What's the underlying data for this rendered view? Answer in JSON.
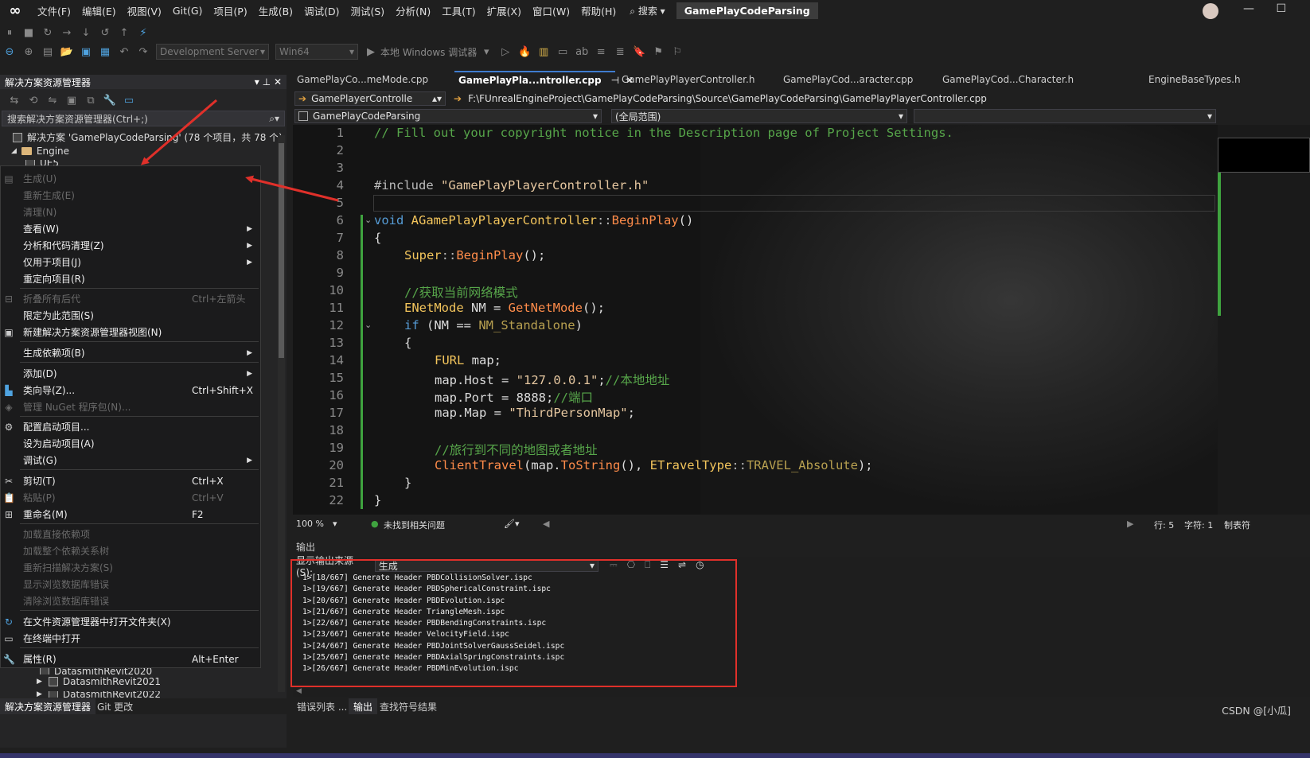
{
  "menubar": {
    "items": [
      "文件(F)",
      "编辑(E)",
      "视图(V)",
      "Git(G)",
      "项目(P)",
      "生成(B)",
      "调试(D)",
      "测试(S)",
      "分析(N)",
      "工具(T)",
      "扩展(X)",
      "窗口(W)",
      "帮助(H)"
    ],
    "search_label": "搜索",
    "solution_name": "GamePlayCodeParsing"
  },
  "toolbar": {
    "config_combo": "Development Server",
    "platform_combo": "Win64",
    "debugger_label": "本地 Windows 调试器"
  },
  "solution_explorer": {
    "title": "解决方案资源管理器",
    "search_placeholder": "搜索解决方案资源管理器(Ctrl+;)",
    "solution_node": "解决方案 'GamePlayCodeParsing' (78 个项目，共 78 个)",
    "engine_folder": "Engine",
    "ue5_node": "UE5",
    "node_datasmith2020": "DatasmithRevit2020",
    "node_datasmith2021": "DatasmithRevit2021",
    "node_datasmith2022": "DatasmithRevit2022",
    "tab_solution": "解决方案资源管理器",
    "tab_git": "Git 更改"
  },
  "context_menu": {
    "build": "生成(U)",
    "rebuild": "重新生成(E)",
    "clean": "清理(N)",
    "view": "查看(W)",
    "analyze": "分析和代码清理(Z)",
    "project_only": "仅用于项目(J)",
    "retarget": "重定向项目(R)",
    "collapse": "折叠所有后代",
    "collapse_sc": "Ctrl+左箭头",
    "scope": "限定为此范围(S)",
    "new_view": "新建解决方案资源管理器视图(N)",
    "build_deps": "生成依赖项(B)",
    "add": "添加(D)",
    "class_wizard": "类向导(Z)...",
    "class_wizard_sc": "Ctrl+Shift+X",
    "nuget": "管理 NuGet 程序包(N)...",
    "config_startup": "配置启动项目...",
    "set_startup": "设为启动项目(A)",
    "debug": "调试(G)",
    "cut": "剪切(T)",
    "cut_sc": "Ctrl+X",
    "paste": "粘贴(P)",
    "paste_sc": "Ctrl+V",
    "rename": "重命名(M)",
    "rename_sc": "F2",
    "load_direct": "加载直接依赖项",
    "load_tree": "加载整个依赖关系树",
    "rescan": "重新扫描解决方案(S)",
    "show_db_errors": "显示浏览数据库错误",
    "clear_db_errors": "清除浏览数据库错误",
    "open_folder": "在文件资源管理器中打开文件夹(X)",
    "open_terminal": "在终端中打开",
    "properties": "属性(R)",
    "properties_sc": "Alt+Enter"
  },
  "editor_tabs": [
    "GamePlayCo...meMode.cpp",
    "GamePlayPla...ntroller.cpp",
    "GamePlayPlayerController.h",
    "GamePlayCod...aracter.cpp",
    "GamePlayCod...Character.h",
    "EngineBaseTypes.h"
  ],
  "nav": {
    "class_combo": "GamePlayerControlle",
    "path": "F:\\FUnrealEngineProject\\GamePlayCodeParsing\\Source\\GamePlayCodeParsing\\GamePlayPlayerController.cpp",
    "project_combo": "GamePlayCodeParsing",
    "scope_combo": "(全局范围)"
  },
  "code": {
    "line_numbers": [
      "1",
      "2",
      "3",
      "4",
      "5",
      "6",
      "7",
      "8",
      "9",
      "10",
      "11",
      "12",
      "13",
      "14",
      "15",
      "16",
      "17",
      "18",
      "19",
      "20",
      "21",
      "22"
    ],
    "l1": "// Fill out your copyright notice in the Description page of Project Settings.",
    "l4_kw": "#include",
    "l4_str": "\"GamePlayPlayerController.h\"",
    "l6_kw": "void",
    "l6_type": "AGamePlayPlayerController",
    "l6_op": "::",
    "l6_fn": "BeginPlay",
    "l6_rest": "()",
    "l7": "{",
    "l8_type": "Super",
    "l8_op": "::",
    "l8_fn": "BeginPlay",
    "l8_rest": "();",
    "l10": "//获取当前网络模式",
    "l11_type": "ENetMode",
    "l11_mid": " NM = ",
    "l11_fn": "GetNetMode",
    "l11_rest": "();",
    "l12_kw": "if",
    "l12_mid": " (NM == ",
    "l12_enum": "NM_Standalone",
    "l12_rest": ")",
    "l13": "{",
    "l14_type": "FURL",
    "l14_rest": " map;",
    "l15_a": "map.Host = ",
    "l15_str": "\"127.0.0.1\"",
    "l15_semi": ";",
    "l15_cm": "//本地地址",
    "l16_a": "map.Port = 8888;",
    "l16_cm": "//端口",
    "l17_a": "map.Map = ",
    "l17_str": "\"ThirdPersonMap\"",
    "l17_semi": ";",
    "l19": "//旅行到不同的地图或者地址",
    "l20_fn": "ClientTravel",
    "l20_a": "(map.",
    "l20_fn2": "ToString",
    "l20_b": "(), ",
    "l20_type": "ETravelType",
    "l20_op": "::",
    "l20_enum": "TRAVEL_Absolute",
    "l20_c": ");",
    "l21": "}",
    "l22": "}"
  },
  "editor_status": {
    "zoom": "100 %",
    "issues": "未找到相关问题",
    "line": "行: 5",
    "col": "字符: 1",
    "tabs": "制表符"
  },
  "output": {
    "title": "输出",
    "source_label": "显示输出来源(S):",
    "source_value": "生成",
    "lines": [
      "1>[18/667] Generate Header PBDCollisionSolver.ispc",
      "1>[19/667] Generate Header PBDSphericalConstraint.ispc",
      "1>[20/667] Generate Header PBDEvolution.ispc",
      "1>[21/667] Generate Header TriangleMesh.ispc",
      "1>[22/667] Generate Header PBDBendingConstraints.ispc",
      "1>[23/667] Generate Header VelocityField.ispc",
      "1>[24/667] Generate Header PBDJointSolverGaussSeidel.ispc",
      "1>[25/667] Generate Header PBDAxialSpringConstraints.ispc",
      "1>[26/667] Generate Header PBDMinEvolution.ispc"
    ]
  },
  "bottom_tabs": {
    "errors": "错误列表 ...",
    "output": "输出",
    "find_symbol": "查找符号结果"
  },
  "watermark": "CSDN @[小瓜]",
  "colors": {
    "accent": "#3f7ccf",
    "annotation_red": "#e0302a",
    "status_bar": "#35346a",
    "change_green": "#3fa33f"
  }
}
